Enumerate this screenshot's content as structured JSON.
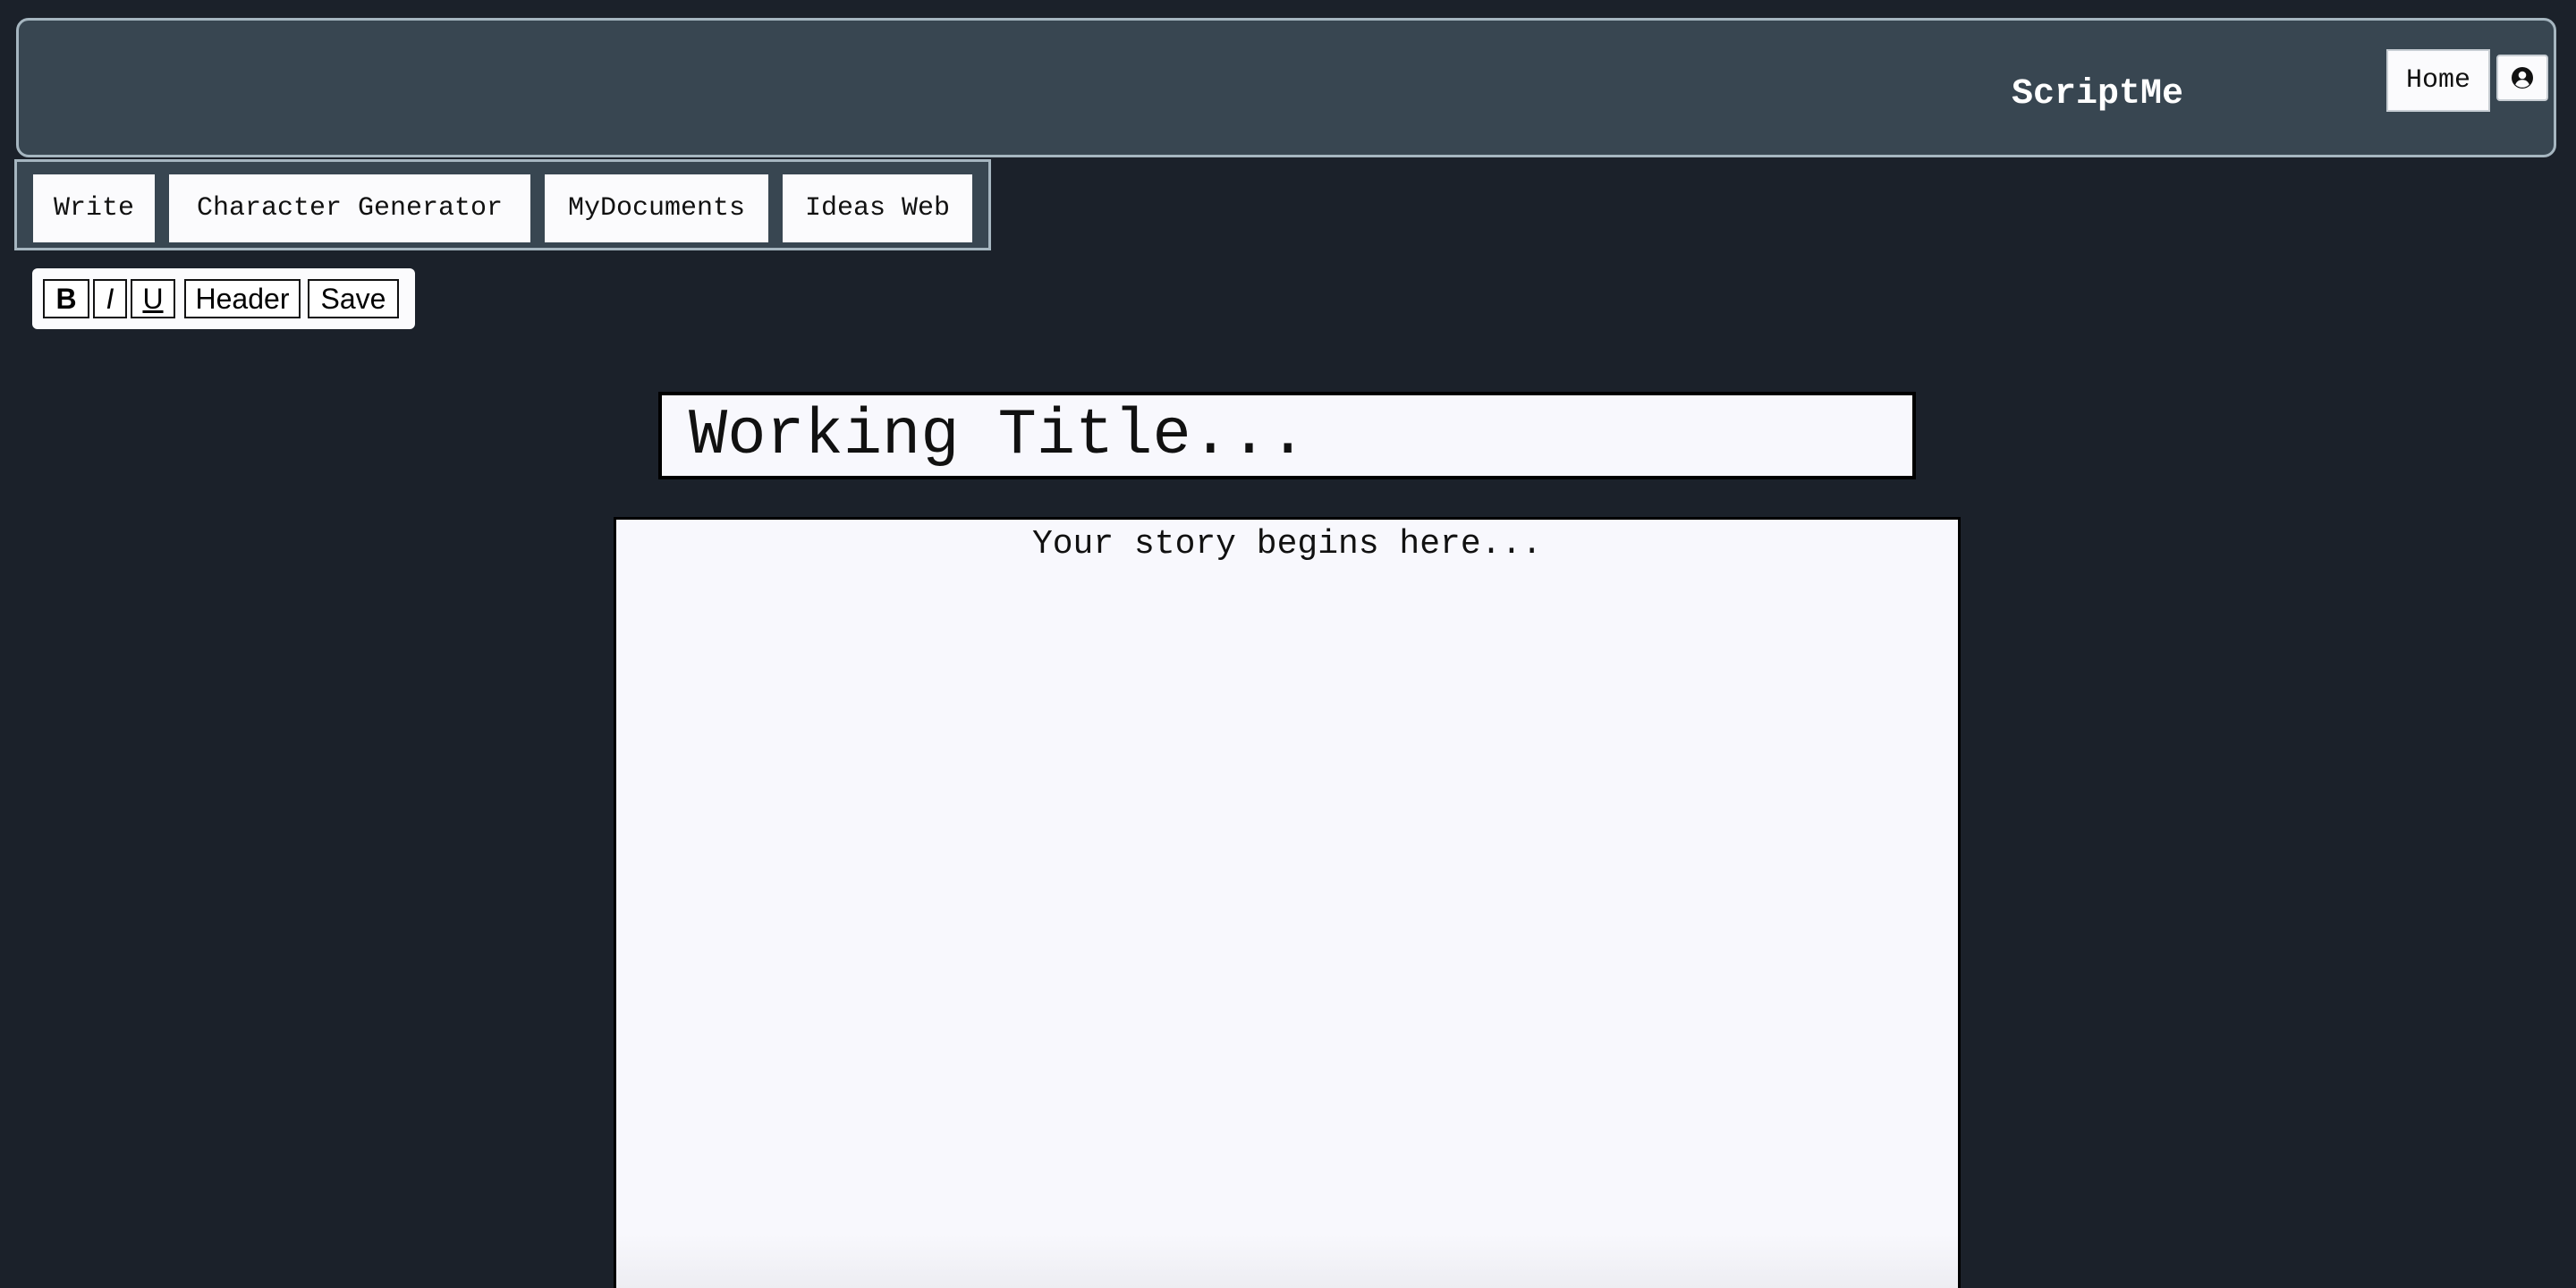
{
  "header": {
    "brand": "ScriptMe",
    "home_label": "Home",
    "account_icon": "user-circle-icon"
  },
  "nav": {
    "items": [
      {
        "label": "Write"
      },
      {
        "label": "Character Generator"
      },
      {
        "label": "MyDocuments"
      },
      {
        "label": "Ideas Web"
      }
    ]
  },
  "toolbar": {
    "bold_label": "B",
    "italic_label": "I",
    "underline_label": "U",
    "header_label": "Header",
    "save_label": "Save"
  },
  "editor": {
    "title_placeholder": "Working Title...",
    "title_value": "",
    "story_placeholder": "Your story begins here...",
    "story_value": ""
  },
  "colors": {
    "background": "#1b212a",
    "header_bg": "#384651",
    "header_border": "#a6b6c0",
    "surface": "#f8f8fd"
  }
}
